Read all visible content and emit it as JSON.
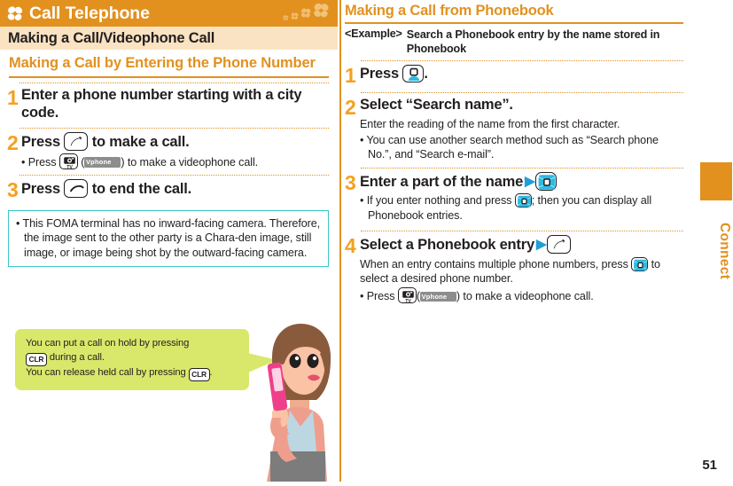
{
  "header": {
    "chapter_title": "Call Telephone",
    "clover_icon": "clover-icon",
    "bg_color": "#e2911f"
  },
  "left": {
    "section_bar_title": "Making a Call/Videophone Call",
    "subsection_title": "Making a Call by Entering the Phone Number",
    "steps": [
      {
        "num": "1",
        "head_before": "Enter a phone number starting with a city code.",
        "head_after": "",
        "key": null,
        "bullets": []
      },
      {
        "num": "2",
        "head_before": "Press",
        "head_after": "to make a call.",
        "key": "call-key-icon",
        "bullets": [
          {
            "before": "• Press",
            "key": "camera-tv-key-icon",
            "softkey": "Vphone",
            "after": ") to make a videophone call."
          }
        ]
      },
      {
        "num": "3",
        "head_before": "Press",
        "head_after": "to end the call.",
        "key": "end-call-key-icon",
        "bullets": []
      }
    ],
    "note": "• This FOMA terminal has no inward-facing camera. Therefore, the image sent to the other party is a Chara-den image, still image, or image being shot by the outward-facing camera.",
    "note_border_color": "#3cc6c9",
    "callout": {
      "bg_color": "#d9e86a",
      "line1_a": "You can put a call on hold by pressing",
      "line1_key": "CLR",
      "line1_b": "during a call.",
      "line2_a": "You can release held call by pressing",
      "line2_key": "CLR",
      "line2_b": "."
    },
    "illustration": "woman-on-phone-illustration"
  },
  "right": {
    "subsection_title": "Making a Call from Phonebook",
    "example_label": "<Example>",
    "example_text": "Search a Phonebook entry by the name stored in Phonebook",
    "steps": [
      {
        "num": "1",
        "head_before": "Press",
        "head_after": ".",
        "key": "phonebook-key-icon",
        "sub": "",
        "bullets": []
      },
      {
        "num": "2",
        "head_before": "Select “Search name”.",
        "head_after": "",
        "key": null,
        "sub": "Enter the reading of the name from the first character.",
        "bullets": [
          {
            "text": "• You can use another search method such as “Search phone No.”, and “Search e-mail”."
          }
        ]
      },
      {
        "num": "3",
        "head_before": "Enter a part of the name",
        "head_after": "",
        "key": "nav-key-icon",
        "arrow": "▶",
        "sub": "",
        "bullets": [
          {
            "before": "• If you enter nothing and press",
            "key": "nav-key-icon",
            "after": "; then you can display all Phonebook entries."
          }
        ]
      },
      {
        "num": "4",
        "head_before": "Select a Phonebook entry",
        "head_after": "",
        "key": "call-key-icon",
        "arrow": "▶",
        "sub_before": "When an entry contains multiple phone numbers, press",
        "sub_key": "nav-key-icon",
        "sub_after": "to select a desired phone number.",
        "bullets": [
          {
            "before": "• Press",
            "key": "camera-tv-key-icon",
            "softkey": "Vphone",
            "after": ") to make a videophone call."
          }
        ]
      }
    ]
  },
  "side_tab": {
    "label": "Connect",
    "color": "#e2911f"
  },
  "page_number": "51"
}
